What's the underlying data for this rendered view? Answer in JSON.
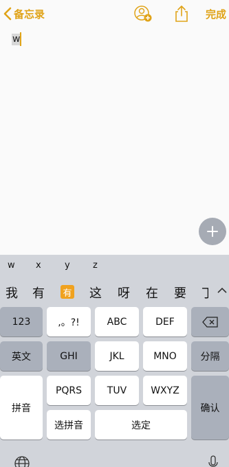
{
  "nav": {
    "back_label": "备忘录",
    "done_label": "完成"
  },
  "note": {
    "text": "w"
  },
  "keyboard": {
    "pinyin": [
      "w",
      "x",
      "y",
      "z"
    ],
    "candidates": [
      "我",
      "有",
      "有",
      "这",
      "呀",
      "在",
      "要",
      "丁"
    ],
    "rows": {
      "r1": [
        "123",
        ",。?!",
        "ABC",
        "DEF"
      ],
      "r2": [
        "英文",
        "GHI",
        "JKL",
        "MNO",
        "分隔"
      ],
      "r3": [
        "拼音",
        "PQRS",
        "TUV",
        "WXYZ",
        "确认"
      ],
      "r4": [
        "选拼音",
        "选定"
      ]
    }
  },
  "colors": {
    "accent": "#e0a318",
    "highlight": "#f0a21f",
    "key_dark": "#aab0bb",
    "key_light": "#ffffff",
    "keyboard_bg": "#d1d4da"
  }
}
